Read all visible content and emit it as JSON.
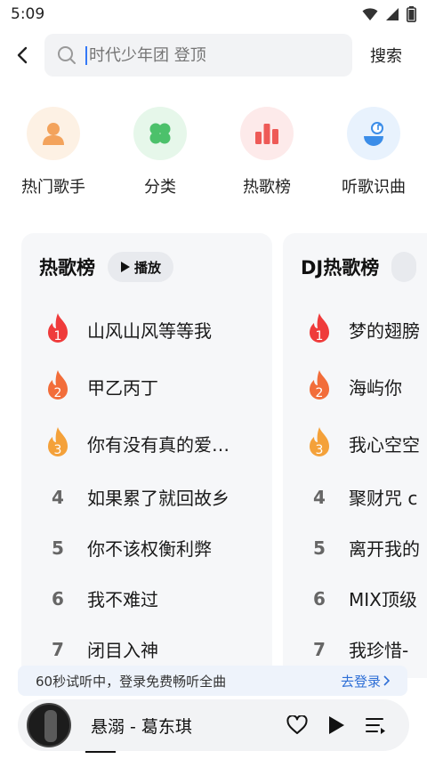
{
  "status": {
    "time": "5:09",
    "icons": [
      "wifi-icon",
      "signal-icon",
      "battery-icon"
    ]
  },
  "search": {
    "back_icon": "back-arrow-icon",
    "search_icon": "search-icon",
    "placeholder": "时代少年团 登顶",
    "action_label": "搜索"
  },
  "quick_links": [
    {
      "label": "热门歌手",
      "icon": "singer-icon",
      "color": "#f3a35c",
      "bg": "#fdf1e4"
    },
    {
      "label": "分类",
      "icon": "clover-icon",
      "color": "#4cc16b",
      "bg": "#e6f7ea"
    },
    {
      "label": "热歌榜",
      "icon": "bar-chart-icon",
      "color": "#ee5a57",
      "bg": "#fdeaea"
    },
    {
      "label": "听歌识曲",
      "icon": "music-recognize-icon",
      "color": "#3b8de8",
      "bg": "#e8f2fd"
    }
  ],
  "charts": [
    {
      "title": "热歌榜",
      "play_label": "播放",
      "songs": [
        {
          "rank": "1",
          "name": "山风山风等等我"
        },
        {
          "rank": "2",
          "name": "甲乙丙丁"
        },
        {
          "rank": "3",
          "name": "你有没有真的爱…"
        },
        {
          "rank": "4",
          "name": "如果累了就回故乡"
        },
        {
          "rank": "5",
          "name": "你不该权衡利弊"
        },
        {
          "rank": "6",
          "name": "我不难过"
        },
        {
          "rank": "7",
          "name": "闭目入神"
        }
      ]
    },
    {
      "title": "DJ热歌榜",
      "songs": [
        {
          "rank": "1",
          "name": "梦的翅膀"
        },
        {
          "rank": "2",
          "name": "海屿你"
        },
        {
          "rank": "3",
          "name": "我心空空"
        },
        {
          "rank": "4",
          "name": "聚财咒 c"
        },
        {
          "rank": "5",
          "name": "离开我的"
        },
        {
          "rank": "6",
          "name": "MIX顶级"
        },
        {
          "rank": "7",
          "name": "我珍惜-"
        }
      ]
    }
  ],
  "trial": {
    "text": "60秒试听中，登录免费畅听全曲",
    "link_label": "去登录"
  },
  "player": {
    "now_playing": "悬溺 - 葛东琪"
  },
  "colors": {
    "rank1": "#ef3b3b",
    "rank2": "#f26d3a",
    "rank3": "#f4a13a",
    "link": "#2e6fd6"
  }
}
